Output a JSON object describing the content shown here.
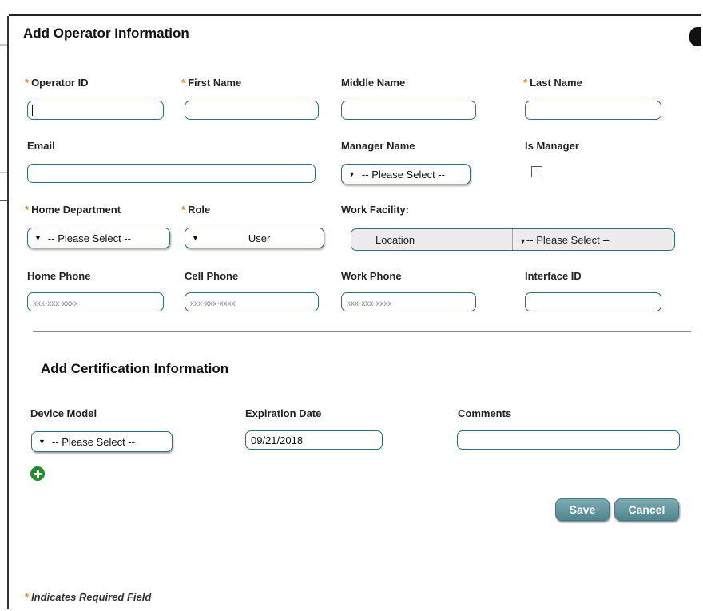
{
  "dialog": {
    "title": "Add Operator Information"
  },
  "required_marker": "*",
  "operator": {
    "operator_id": {
      "label": "Operator ID",
      "value": ""
    },
    "first_name": {
      "label": "First Name",
      "value": ""
    },
    "middle_name": {
      "label": "Middle Name",
      "value": ""
    },
    "last_name": {
      "label": "Last Name",
      "value": ""
    },
    "email": {
      "label": "Email",
      "value": ""
    },
    "manager_name": {
      "label": "Manager Name",
      "selected": "-- Please Select --"
    },
    "is_manager": {
      "label": "Is Manager",
      "checked": false
    },
    "home_department": {
      "label": "Home Department",
      "selected": "-- Please Select --"
    },
    "role": {
      "label": "Role",
      "selected": "User"
    },
    "work_facility": {
      "label": "Work Facility:",
      "location": "Location",
      "selected": "-- Please Select --"
    },
    "home_phone": {
      "label": "Home Phone",
      "placeholder": "xxx-xxx-xxxx"
    },
    "cell_phone": {
      "label": "Cell Phone",
      "placeholder": "xxx-xxx-xxxx"
    },
    "work_phone": {
      "label": "Work Phone",
      "placeholder": "xxx-xxx-xxxx"
    },
    "interface_id": {
      "label": "Interface ID",
      "value": ""
    }
  },
  "certification": {
    "title": "Add Certification Information",
    "device_model": {
      "label": "Device Model",
      "selected": "-- Please Select --"
    },
    "expiration_date": {
      "label": "Expiration Date",
      "value": "09/21/2018"
    },
    "comments": {
      "label": "Comments",
      "value": ""
    },
    "add_icon": "plus-circle-icon"
  },
  "actions": {
    "save": "Save",
    "cancel": "Cancel"
  },
  "footer": {
    "note": "Indicates Required Field"
  },
  "colors": {
    "accent": "#2f6f79",
    "required": "#f08a00",
    "button": "#5e929b",
    "add_icon": "#1f8f2a"
  }
}
